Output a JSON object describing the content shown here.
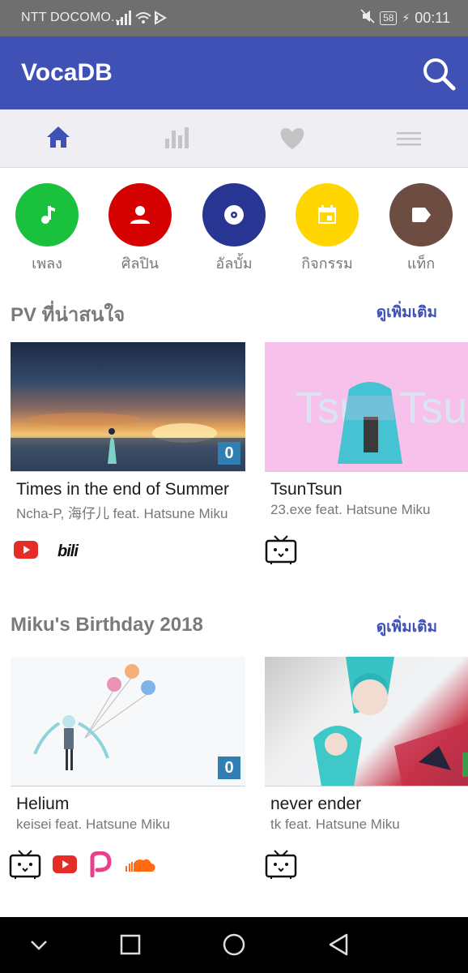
{
  "status_bar": {
    "carrier": "NTT DOCOMO...",
    "battery": "58",
    "time": "00:11"
  },
  "app_bar": {
    "title": "VocaDB",
    "search_icon": "search-icon"
  },
  "tabs": [
    {
      "icon": "home-icon",
      "active": true
    },
    {
      "icon": "bar-chart-icon",
      "active": false
    },
    {
      "icon": "heart-icon",
      "active": false
    },
    {
      "icon": "menu-icon",
      "active": false
    }
  ],
  "categories": [
    {
      "label": "เพลง",
      "icon": "music-note-icon",
      "color": "#19c13c"
    },
    {
      "label": "ศิลปิน",
      "icon": "person-icon",
      "color": "#d50000"
    },
    {
      "label": "อัลบั้ม",
      "icon": "disc-icon",
      "color": "#283593"
    },
    {
      "label": "กิจกรรม",
      "icon": "calendar-icon",
      "color": "#ffd600"
    },
    {
      "label": "แท็ก",
      "icon": "tag-icon",
      "color": "#6d4c41"
    }
  ],
  "sections": [
    {
      "title": "PV ที่น่าสนใจ",
      "more": "ดูเพิ่มเติม",
      "cards": [
        {
          "title": "Times in the end of Summer",
          "artist": "Ncha-P, 海仔儿 feat. Hatsune Miku",
          "rating": "0",
          "services": [
            "youtube-icon",
            "bilibili-icon"
          ]
        },
        {
          "title": "TsunTsun",
          "artist": "23.exe feat. Hatsune Miku",
          "thumb_text": "Tsun Tsun",
          "services": [
            "niconico-icon"
          ]
        }
      ]
    },
    {
      "title": "Miku's Birthday 2018",
      "more": "ดูเพิ่มเติม",
      "cards": [
        {
          "title": "Helium",
          "artist": "keisei feat. Hatsune Miku",
          "rating": "0",
          "services": [
            "niconico-icon",
            "youtube-icon",
            "piapro-icon",
            "soundcloud-icon"
          ]
        },
        {
          "title": "never ender",
          "artist": "tk feat. Hatsune Miku",
          "services": [
            "niconico-icon"
          ]
        }
      ]
    }
  ],
  "colors": {
    "primary": "#3f51b5",
    "status_bar": "#6f6f6f",
    "rating_badge": "#2f7fb5"
  },
  "nav_bar": [
    "back-chevron-icon",
    "square-icon",
    "circle-icon",
    "triangle-back-icon"
  ]
}
